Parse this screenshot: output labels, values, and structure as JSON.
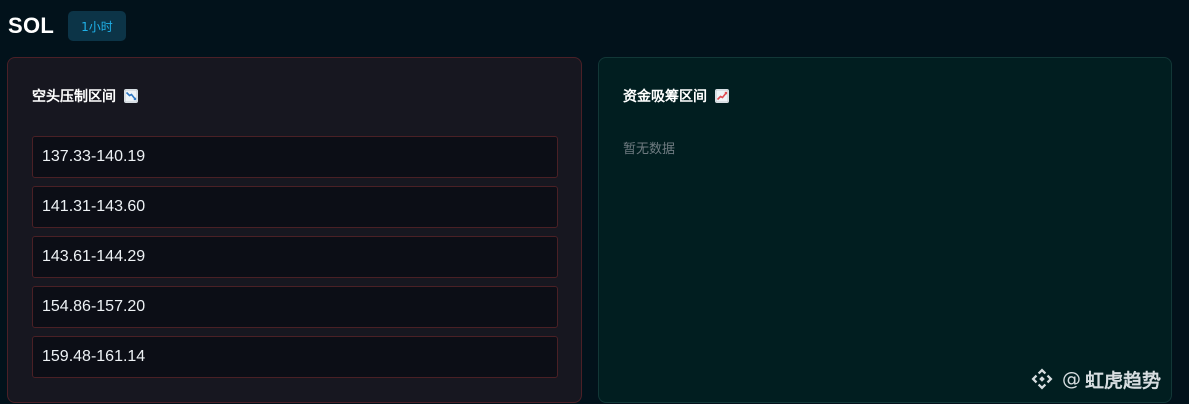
{
  "header": {
    "symbol": "SOL",
    "timeframe": "1小时"
  },
  "short_zone": {
    "title": "空头压制区间",
    "icon": "chart-decreasing-icon",
    "ranges": [
      "137.33-140.19",
      "141.31-143.60",
      "143.61-144.29",
      "154.86-157.20",
      "159.48-161.14"
    ]
  },
  "accumulation_zone": {
    "title": "资金吸筹区间",
    "icon": "chart-increasing-icon",
    "empty_text": "暂无数据"
  },
  "watermark": {
    "at": "@",
    "brand": "虹虎趋势",
    "icon": "binance-diamond-icon"
  },
  "colors": {
    "background": "#02121b",
    "badge_text": "#1fb1e8",
    "short_border": "#4b2027",
    "accum_panel": "#011e20"
  }
}
